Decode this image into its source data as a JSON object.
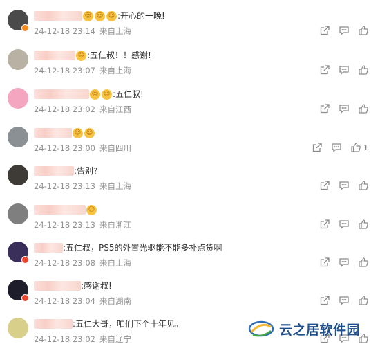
{
  "comments": [
    {
      "name_blur_width": 70,
      "text": ":开心的一晚!",
      "emoji_count": 3,
      "timestamp": "24-12-18 23:14",
      "location": "来自上海",
      "likes": "",
      "badge": "orange",
      "avatar_color": "#4a4a4a"
    },
    {
      "name_blur_width": 60,
      "text": ":五仁叔！！感谢!",
      "emoji_count": 1,
      "timestamp": "24-12-18 23:07",
      "location": "来自上海",
      "likes": "",
      "badge": "",
      "avatar_color": "#b9b1a3"
    },
    {
      "name_blur_width": 80,
      "text": ":五仁叔!",
      "emoji_count": 2,
      "timestamp": "24-12-18 23:02",
      "location": "来自江西",
      "likes": "",
      "badge": "",
      "avatar_color": "#f4a6c1"
    },
    {
      "name_blur_width": 55,
      "text": "",
      "emoji_count": 2,
      "timestamp": "24-12-18 23:00",
      "location": "来自四川",
      "likes": "1",
      "badge": "",
      "avatar_color": "#8a9094"
    },
    {
      "name_blur_width": 58,
      "text": ":告别?",
      "emoji_count": 0,
      "timestamp": "24-12-18 23:13",
      "location": "来自上海",
      "likes": "",
      "badge": "",
      "avatar_color": "#3e3a35"
    },
    {
      "name_blur_width": 75,
      "text": "",
      "emoji_count": 1,
      "timestamp": "24-12-18 23:13",
      "location": "来自浙江",
      "likes": "",
      "badge": "",
      "avatar_color": "#7f7f7f"
    },
    {
      "name_blur_width": 42,
      "text": ":五仁叔，PS5的外置光驱能不能多补点货啊",
      "emoji_count": 0,
      "timestamp": "24-12-18 23:08",
      "location": "来自上海",
      "likes": "",
      "badge": "red",
      "avatar_color": "#3a2f5a"
    },
    {
      "name_blur_width": 68,
      "text": ":感谢叔!",
      "emoji_count": 0,
      "timestamp": "24-12-18 23:04",
      "location": "来自湖南",
      "likes": "",
      "badge": "red",
      "avatar_color": "#1d1d2b"
    },
    {
      "name_blur_width": 56,
      "text": ":五仁大哥，咱们下个十年见。",
      "emoji_count": 0,
      "timestamp": "24-12-18 23:02",
      "location": "来自辽宁",
      "likes": "",
      "badge": "",
      "avatar_color": "#d8cf8a"
    }
  ],
  "watermark": {
    "text": "云之居软件园"
  },
  "icons": {
    "share": "share-icon",
    "comment": "comment-icon",
    "like": "thumbs-up-icon"
  }
}
